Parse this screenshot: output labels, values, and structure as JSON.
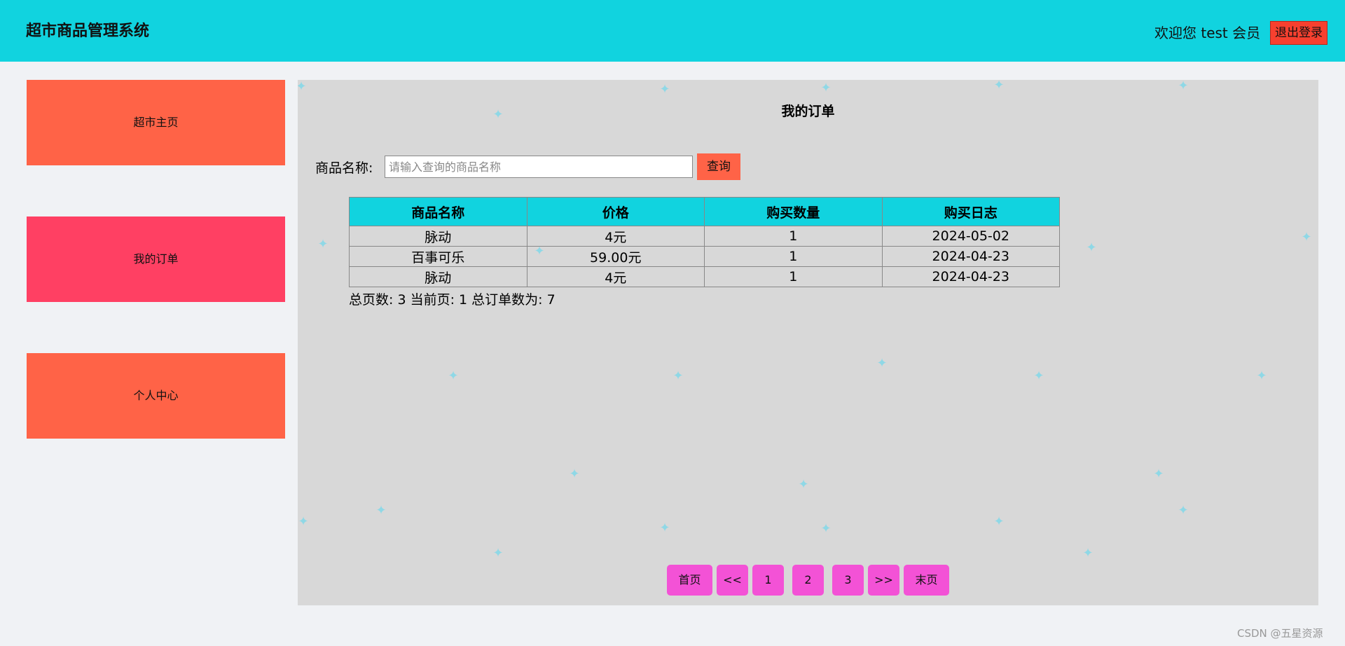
{
  "header": {
    "title": "超市商品管理系统",
    "welcome": "欢迎您 test 会员",
    "logout_label": "退出登录",
    "bg_color": "#11d3df"
  },
  "sidebar": {
    "items": [
      {
        "label": "超市主页",
        "color": "#ff6347"
      },
      {
        "label": "我的订单",
        "color": "#ff4063",
        "active": true
      },
      {
        "label": "个人中心",
        "color": "#ff6347"
      }
    ]
  },
  "main": {
    "title": "我的订单",
    "search": {
      "label": "商品名称:",
      "placeholder": "请输入查询的商品名称",
      "value": "",
      "button_label": "查询"
    },
    "table": {
      "columns": [
        "商品名称",
        "价格",
        "购买数量",
        "购买日志"
      ],
      "rows": [
        [
          "脉动",
          "4元",
          "1",
          "2024-05-02"
        ],
        [
          "百事可乐",
          "59.00元",
          "1",
          "2024-04-23"
        ],
        [
          "脉动",
          "4元",
          "1",
          "2024-04-23"
        ]
      ]
    },
    "summary": "总页数: 3 当前页: 1 总订单数为: 7",
    "pagination": {
      "first": "首页",
      "prev": "<<",
      "pages": [
        "1",
        "2",
        "3"
      ],
      "next": ">>",
      "last": "末页"
    }
  },
  "watermark": "CSDN @五星资源"
}
